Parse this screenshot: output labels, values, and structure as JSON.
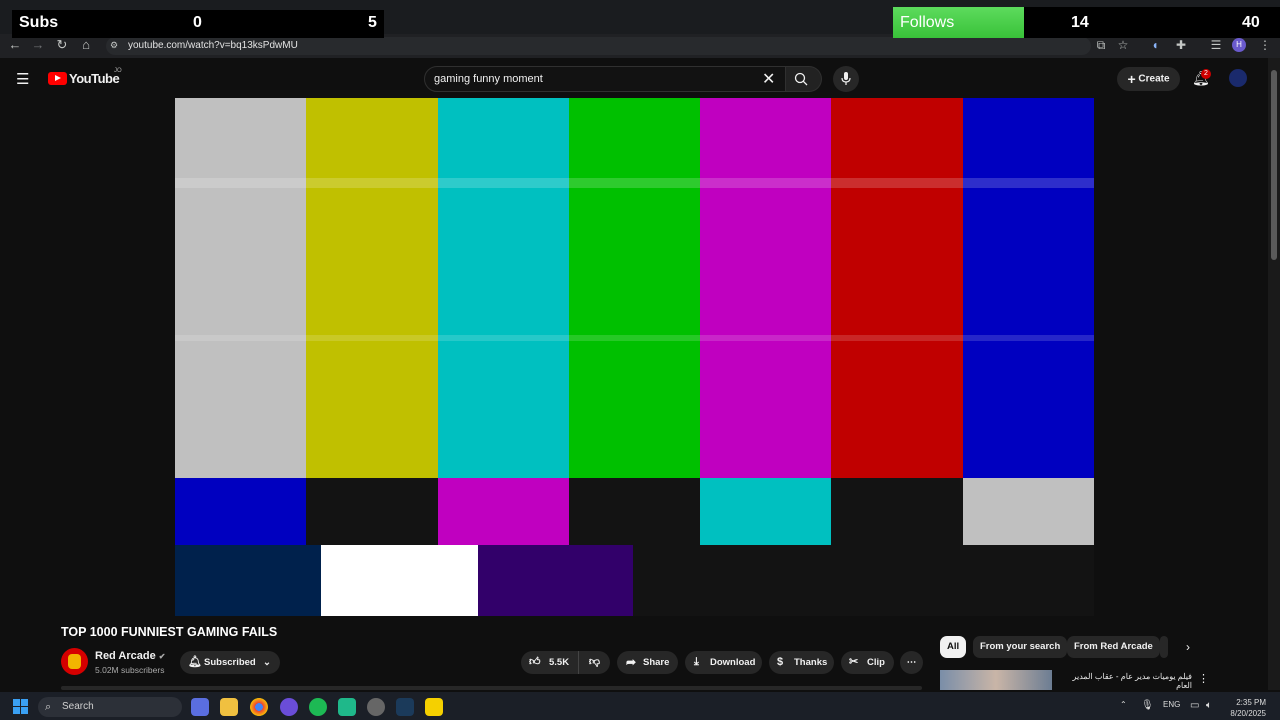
{
  "overlay": {
    "subs_label": "Subs",
    "subs_current": "0",
    "subs_goal": "5",
    "follows_label": "Follows",
    "follows_current": "14",
    "follows_goal": "40"
  },
  "browser": {
    "url": "youtube.com/watch?v=bq13ksPdwMU",
    "profile_initial": "H"
  },
  "youtube": {
    "logo_text": "YouTube",
    "logo_badge": "JO",
    "search_value": "gaming funny moment",
    "create_label": "Create",
    "notification_count": "2"
  },
  "video": {
    "title": "TOP 1000 FUNNIEST GAMING FAILS",
    "channel": "Red Arcade",
    "subscribers": "5.02M subscribers",
    "subscribed_label": "Subscribed",
    "likes": "5.5K",
    "share_label": "Share",
    "download_label": "Download",
    "thanks_label": "Thanks",
    "clip_label": "Clip",
    "test_pattern_top": [
      "#c0c0c0",
      "#c0c000",
      "#00c0c0",
      "#00c000",
      "#c000c0",
      "#c00000",
      "#0000c0"
    ],
    "test_pattern_mid": [
      "#0000c0",
      "#131313",
      "#c000c0",
      "#131313",
      "#00c0c0",
      "#131313",
      "#c0c0c0"
    ],
    "test_pattern_bottom": [
      "#00214c",
      "#ffffff",
      "#32006a",
      "#131313"
    ]
  },
  "recommendations": {
    "chips": [
      "All",
      "From your search",
      "From Red Arcade"
    ],
    "first_title": "فيلم يوميات مدير عام - عقاب المدير العام"
  },
  "taskbar": {
    "search_label": "Search",
    "language": "ENG",
    "time": "2:35 PM",
    "date": "8/20/2025"
  }
}
